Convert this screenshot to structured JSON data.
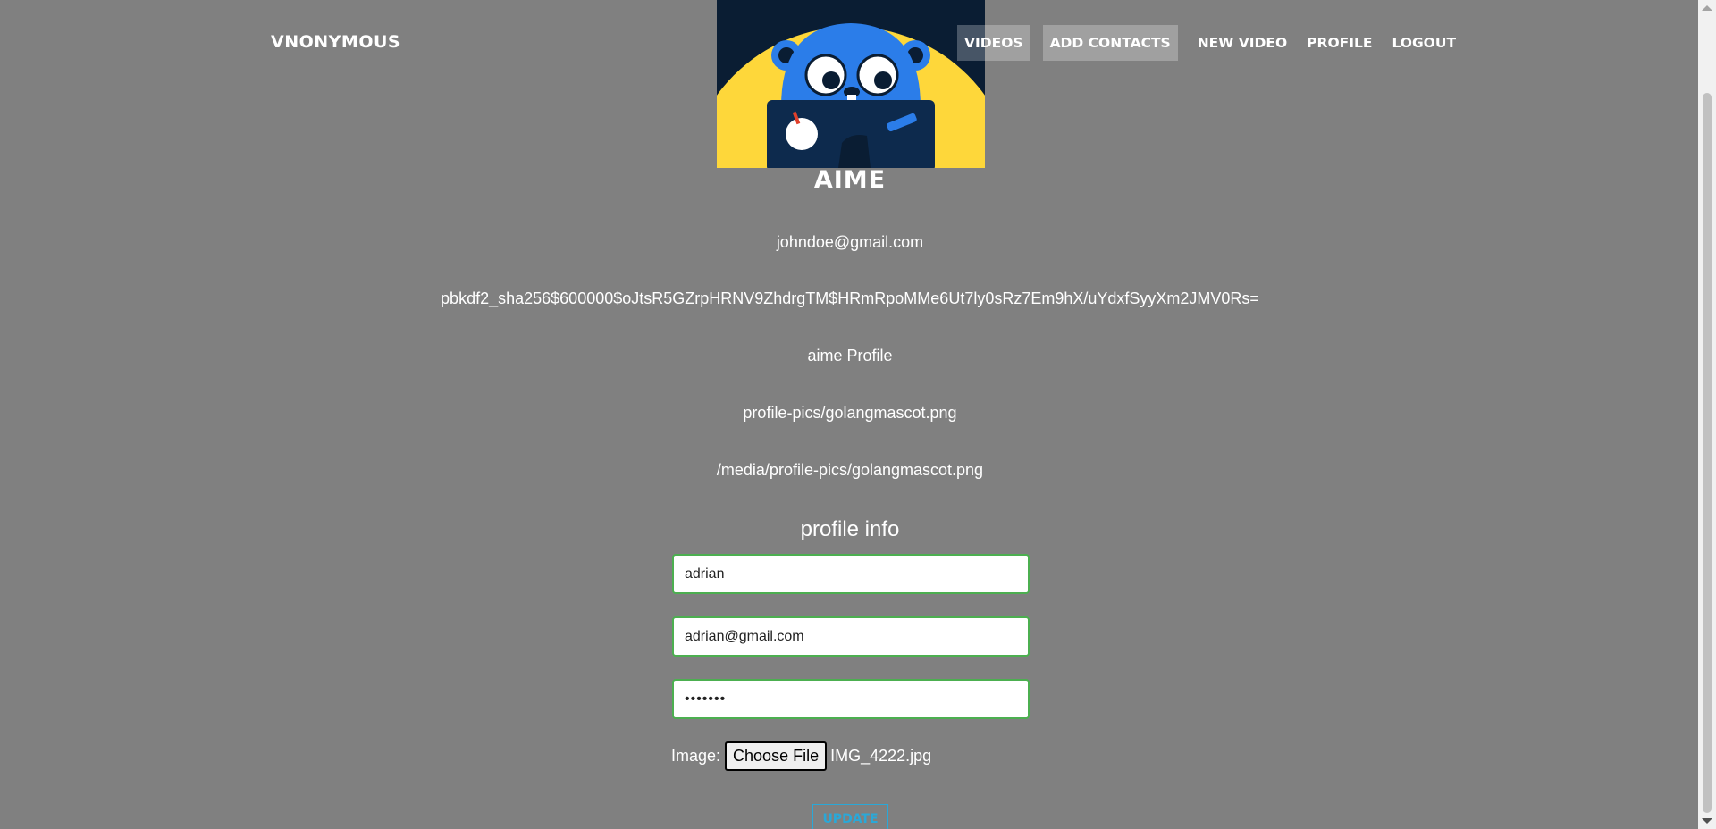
{
  "navbar": {
    "brand": "VNONYMOUS",
    "links": [
      {
        "label": "VIDEOS"
      },
      {
        "label": "ADD CONTACTS"
      },
      {
        "label": "NEW VIDEO"
      },
      {
        "label": "PROFILE"
      },
      {
        "label": "LOGOUT"
      }
    ]
  },
  "profile": {
    "avatar_icon": "gopher-mascot-icon",
    "username": "AIME",
    "email": "johndoe@gmail.com",
    "password_hash": "pbkdf2_sha256$600000$oJtsR5GZrpHRNV9ZhdrgTM$HRmRpoMMe6Ut7ly0sRz7Em9hX/uYdxfSyyXm2JMV0Rs=",
    "profile_name": "aime Profile",
    "image_path": "profile-pics/golangmascot.png",
    "image_url": "/media/profile-pics/golangmascot.png"
  },
  "form": {
    "title": "profile info",
    "username_value": "adrian",
    "email_value": "adrian@gmail.com",
    "password_value": "•••••••",
    "image_label": "Image:",
    "choose_file_label": "Choose File",
    "chosen_file": "IMG_4222.jpg",
    "update_label": "UPDATE"
  },
  "colors": {
    "background": "#808080",
    "field_border": "#4caf50",
    "update_accent": "#2aa8d8"
  }
}
